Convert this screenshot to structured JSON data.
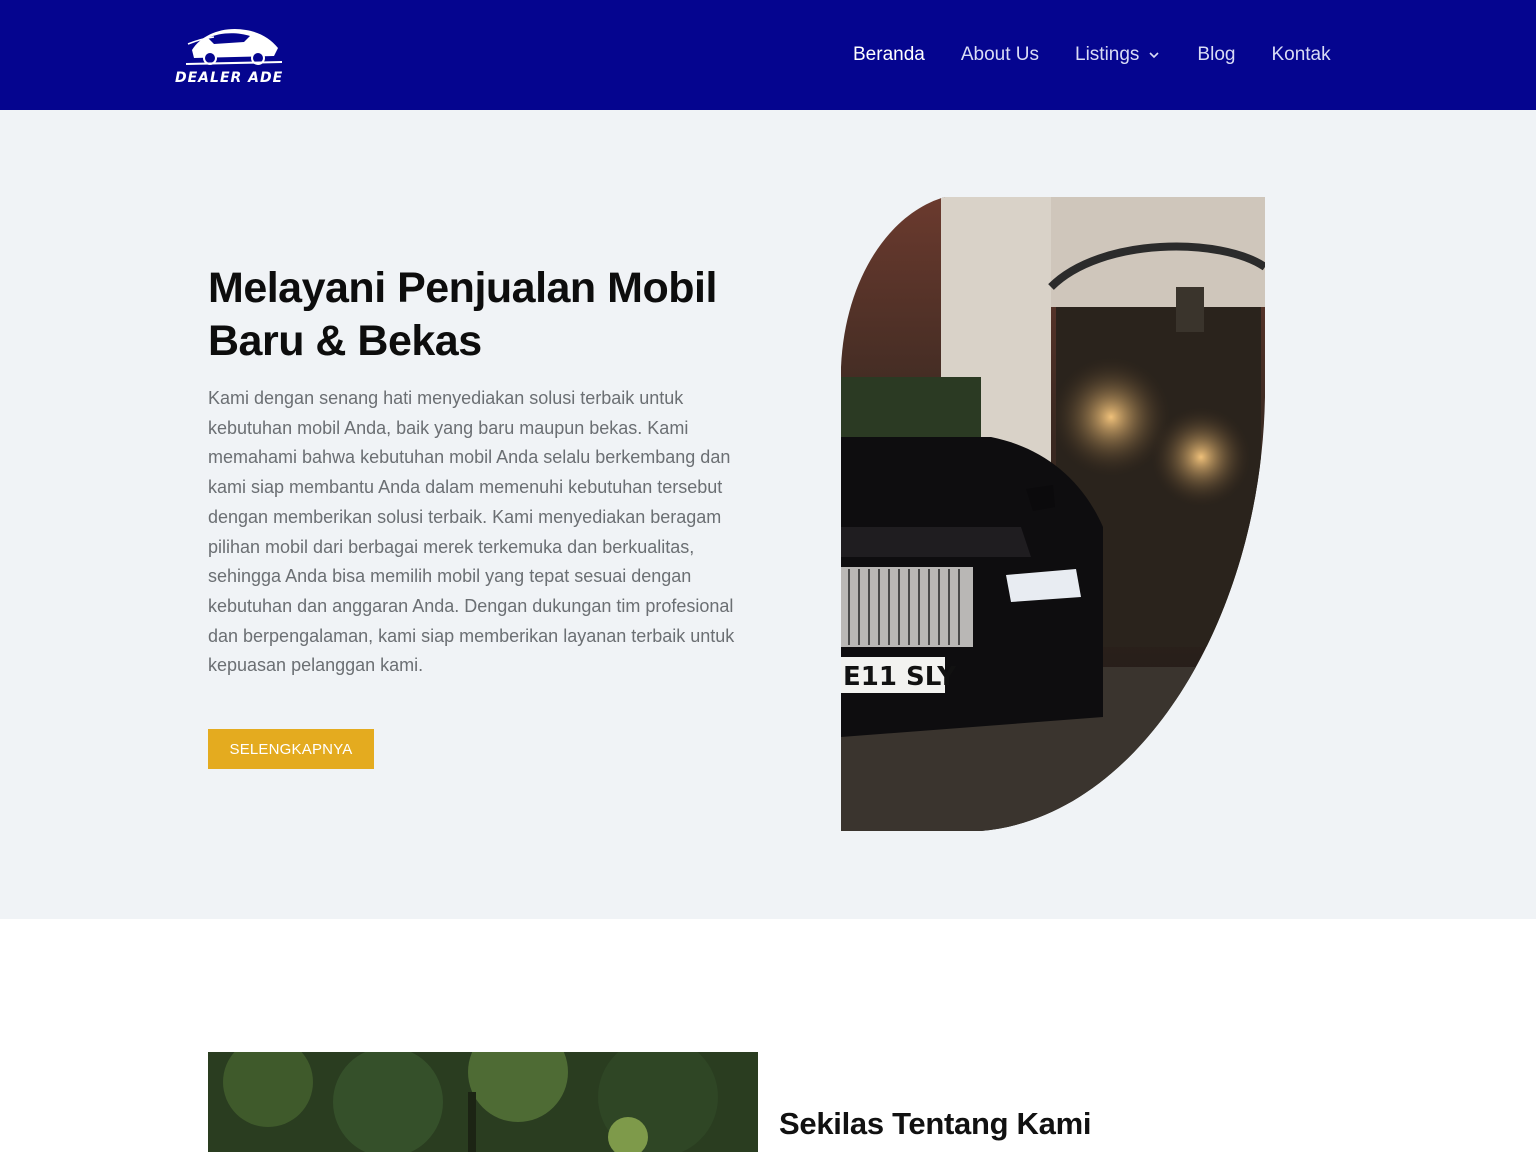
{
  "brand": {
    "name": "DEALER ADE"
  },
  "nav": {
    "items": [
      {
        "label": "Beranda",
        "active": true
      },
      {
        "label": "About Us",
        "active": false
      },
      {
        "label": "Listings",
        "active": false,
        "has_dropdown": true
      },
      {
        "label": "Blog",
        "active": false
      },
      {
        "label": "Kontak",
        "active": false
      }
    ]
  },
  "hero": {
    "title": "Melayani Penjualan Mobil Baru & Bekas",
    "description": "Kami dengan senang hati menyediakan solusi terbaik untuk kebutuhan mobil Anda, baik yang baru maupun bekas. Kami memahami bahwa kebutuhan mobil Anda selalu berkembang dan kami siap membantu Anda dalam memenuhi kebutuhan tersebut dengan memberikan solusi terbaik. Kami menyediakan beragam pilihan mobil dari berbagai merek terkemuka dan berkualitas, sehingga Anda bisa memilih mobil yang tepat sesuai dengan kebutuhan dan anggaran Anda. Dengan dukungan tim profesional dan berpengalaman, kami siap memberikan layanan terbaik untuk kepuasan pelanggan kami.",
    "button_label": "SELENGKAPNYA",
    "plate_text": "E11 SLY"
  },
  "about": {
    "title": "Sekilas Tentang Kami"
  },
  "colors": {
    "header_bg": "#05058f",
    "hero_bg": "#f0f3f6",
    "button": "#e4ab1f"
  }
}
